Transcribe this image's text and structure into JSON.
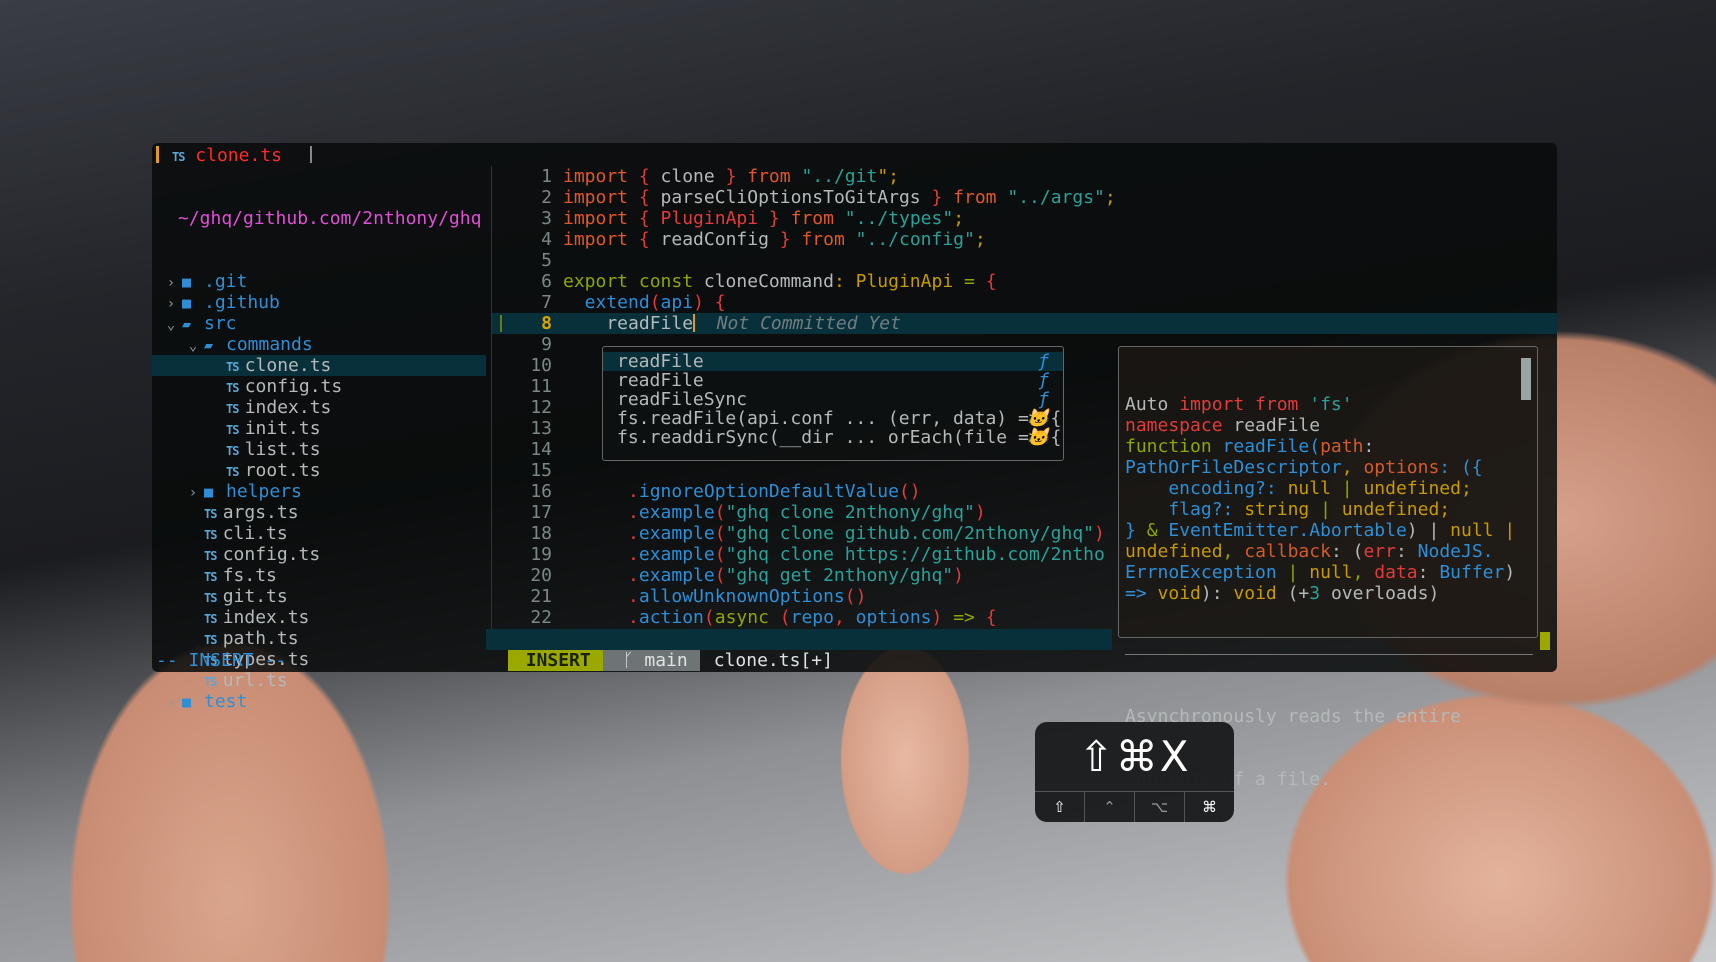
{
  "tabline": {
    "icon": "TS",
    "filename": "clone.ts"
  },
  "explorer": {
    "root_path": "~/ghq/github.com/2nthony/ghq",
    "items": [
      {
        "type": "dir",
        "name": ".git",
        "depth": 0,
        "open": false
      },
      {
        "type": "dir",
        "name": ".github",
        "depth": 0,
        "open": false
      },
      {
        "type": "dir",
        "name": "src",
        "depth": 0,
        "open": true
      },
      {
        "type": "dir",
        "name": "commands",
        "depth": 1,
        "open": true
      },
      {
        "type": "file",
        "name": "clone.ts",
        "depth": 2,
        "selected": true
      },
      {
        "type": "file",
        "name": "config.ts",
        "depth": 2
      },
      {
        "type": "file",
        "name": "index.ts",
        "depth": 2
      },
      {
        "type": "file",
        "name": "init.ts",
        "depth": 2
      },
      {
        "type": "file",
        "name": "list.ts",
        "depth": 2
      },
      {
        "type": "file",
        "name": "root.ts",
        "depth": 2
      },
      {
        "type": "dir",
        "name": "helpers",
        "depth": 1,
        "open": false
      },
      {
        "type": "file",
        "name": "args.ts",
        "depth": 1
      },
      {
        "type": "file",
        "name": "cli.ts",
        "depth": 1
      },
      {
        "type": "file",
        "name": "config.ts",
        "depth": 1
      },
      {
        "type": "file",
        "name": "fs.ts",
        "depth": 1
      },
      {
        "type": "file",
        "name": "git.ts",
        "depth": 1
      },
      {
        "type": "file",
        "name": "index.ts",
        "depth": 1
      },
      {
        "type": "file",
        "name": "path.ts",
        "depth": 1
      },
      {
        "type": "file",
        "name": "types.ts",
        "depth": 1
      },
      {
        "type": "file",
        "name": "url.ts",
        "depth": 1
      },
      {
        "type": "dir",
        "name": "test",
        "depth": 0,
        "open": false
      }
    ]
  },
  "editor": {
    "current_line": 8,
    "lines": [
      {
        "n": 1,
        "t": [
          [
            "import",
            "k"
          ],
          [
            " { ",
            "b"
          ],
          [
            "clone",
            "d"
          ],
          [
            " } ",
            "b"
          ],
          [
            "from",
            "k"
          ],
          [
            " \"",
            "s"
          ],
          [
            "../git",
            "s"
          ],
          [
            "\";",
            "y"
          ]
        ]
      },
      {
        "n": 2,
        "t": [
          [
            "import",
            "k"
          ],
          [
            " { ",
            "b"
          ],
          [
            "parseCliOptionsToGitArgs",
            "d"
          ],
          [
            " } ",
            "b"
          ],
          [
            "from",
            "k"
          ],
          [
            " \"../args\"",
            "s"
          ],
          [
            ";",
            "y"
          ]
        ]
      },
      {
        "n": 3,
        "t": [
          [
            "import",
            "k"
          ],
          [
            " { ",
            "b"
          ],
          [
            "PluginApi",
            "b"
          ],
          [
            " } ",
            "b"
          ],
          [
            "from",
            "k"
          ],
          [
            " \"../types\"",
            "s"
          ],
          [
            ";",
            "y"
          ]
        ]
      },
      {
        "n": 4,
        "t": [
          [
            "import",
            "k"
          ],
          [
            " { ",
            "b"
          ],
          [
            "readConfig",
            "d"
          ],
          [
            " } ",
            "b"
          ],
          [
            "from",
            "k"
          ],
          [
            " \"../config\"",
            "s"
          ],
          [
            ";",
            "y"
          ]
        ]
      },
      {
        "n": 5,
        "t": []
      },
      {
        "n": 6,
        "t": [
          [
            "export const",
            "g"
          ],
          [
            " cloneCommand",
            "d"
          ],
          [
            ": ",
            "y"
          ],
          [
            "PluginApi",
            "y"
          ],
          [
            " = ",
            "g"
          ],
          [
            "{",
            "b"
          ]
        ]
      },
      {
        "n": 7,
        "t": [
          [
            "  extend",
            "u"
          ],
          [
            "(",
            "b"
          ],
          [
            "api",
            "u"
          ],
          [
            ") ",
            "b"
          ],
          [
            "{",
            "b"
          ]
        ]
      },
      {
        "n": 8,
        "t": [
          [
            "    readFile",
            "d"
          ],
          [
            "|cursor",
            ""
          ],
          [
            "  Not Committed Yet",
            "c"
          ]
        ]
      },
      {
        "n": 9,
        "t": []
      },
      {
        "n": 10,
        "t": []
      },
      {
        "n": 11,
        "t": []
      },
      {
        "n": 12,
        "t": []
      },
      {
        "n": 13,
        "t": []
      },
      {
        "n": 14,
        "t": []
      },
      {
        "n": 15,
        "t": []
      },
      {
        "n": 16,
        "t": [
          [
            "      .",
            "b"
          ],
          [
            "ignoreOptionDefaultValue",
            "u"
          ],
          [
            "()",
            "b"
          ]
        ]
      },
      {
        "n": 17,
        "t": [
          [
            "      .",
            "b"
          ],
          [
            "example",
            "u"
          ],
          [
            "(",
            "b"
          ],
          [
            "\"ghq clone 2nthony/ghq\"",
            "s"
          ],
          [
            ")",
            "b"
          ]
        ]
      },
      {
        "n": 18,
        "t": [
          [
            "      .",
            "b"
          ],
          [
            "example",
            "u"
          ],
          [
            "(",
            "b"
          ],
          [
            "\"ghq clone github.com/2nthony/ghq\"",
            "s"
          ],
          [
            ")",
            "b"
          ]
        ]
      },
      {
        "n": 19,
        "t": [
          [
            "      .",
            "b"
          ],
          [
            "example",
            "u"
          ],
          [
            "(",
            "b"
          ],
          [
            "\"ghq clone https://github.com/2ntho",
            "s"
          ]
        ]
      },
      {
        "n": 20,
        "t": [
          [
            "      .",
            "b"
          ],
          [
            "example",
            "u"
          ],
          [
            "(",
            "b"
          ],
          [
            "\"ghq get 2nthony/ghq\"",
            "s"
          ],
          [
            ")",
            "b"
          ]
        ]
      },
      {
        "n": 21,
        "t": [
          [
            "      .",
            "b"
          ],
          [
            "allowUnknownOptions",
            "u"
          ],
          [
            "()",
            "b"
          ]
        ]
      },
      {
        "n": 22,
        "t": [
          [
            "      .",
            "b"
          ],
          [
            "action",
            "u"
          ],
          [
            "(",
            "b"
          ],
          [
            "async",
            "g"
          ],
          [
            " (",
            "b"
          ],
          [
            "repo",
            "u"
          ],
          [
            ", ",
            "b"
          ],
          [
            "options",
            "u"
          ],
          [
            ") ",
            "b"
          ],
          [
            "=>",
            "g"
          ],
          [
            " {",
            "b"
          ]
        ]
      }
    ]
  },
  "completion": {
    "items": [
      {
        "label": "readFile",
        "kind": "ƒ",
        "kind_icon": "function-icon",
        "selected": true
      },
      {
        "label": "readFile",
        "kind": "ƒ",
        "kind_icon": "function-icon"
      },
      {
        "label": "readFileSync",
        "kind": "ƒ",
        "kind_icon": "function-icon"
      },
      {
        "label": "fs.readFile(api.conf ... (err, data) => {",
        "kind": "🐱",
        "kind_icon": "snippet-cat-icon"
      },
      {
        "label": "fs.readdirSync(__dir ... orEach(file => {",
        "kind": "🐱",
        "kind_icon": "snippet-cat-icon"
      }
    ]
  },
  "documentation": {
    "signature": [
      [
        [
          "Auto ",
          "d"
        ],
        [
          "import from",
          "b"
        ],
        [
          " 'fs'",
          "s"
        ]
      ],
      [
        [
          "namespace",
          "b"
        ],
        [
          " readFile",
          "d"
        ]
      ],
      [
        [
          "function",
          "g"
        ],
        [
          " readFile(",
          "u"
        ],
        [
          "path",
          "o"
        ],
        [
          ":",
          "d"
        ]
      ],
      [
        [
          "PathOrFileDescriptor",
          "u"
        ],
        [
          ", ",
          "y"
        ],
        [
          "options",
          "o"
        ],
        [
          ": ({",
          "u"
        ]
      ],
      [
        [
          "    encoding?: ",
          "u"
        ],
        [
          "null",
          "y"
        ],
        [
          " | ",
          "g"
        ],
        [
          "undefined;",
          "y"
        ]
      ],
      [
        [
          "    flag?: ",
          "u"
        ],
        [
          "string",
          "y"
        ],
        [
          " | ",
          "g"
        ],
        [
          "undefined;",
          "y"
        ]
      ],
      [
        [
          "} ",
          "u"
        ],
        [
          "& ",
          "g"
        ],
        [
          "EventEmitter.Abortable",
          "u"
        ],
        [
          ") | ",
          "d"
        ],
        [
          "null |",
          "y"
        ]
      ],
      [
        [
          "undefined",
          "y"
        ],
        [
          ", ",
          "g"
        ],
        [
          "callback",
          "o"
        ],
        [
          ": (",
          "d"
        ],
        [
          "err",
          "b"
        ],
        [
          ": ",
          "d"
        ],
        [
          "NodeJS.",
          "u"
        ]
      ],
      [
        [
          "ErrnoException",
          "u"
        ],
        [
          " | ",
          "g"
        ],
        [
          "null",
          "y"
        ],
        [
          ", ",
          "g"
        ],
        [
          "data",
          "b"
        ],
        [
          ": ",
          "d"
        ],
        [
          "Buffer",
          "u"
        ],
        [
          ")",
          "d"
        ]
      ],
      [
        [
          "=>",
          "u"
        ],
        [
          " void",
          "y"
        ],
        [
          "): ",
          "d"
        ],
        [
          "void",
          "y"
        ],
        [
          " (+",
          "d"
        ],
        [
          "3",
          "s"
        ],
        [
          " overloads)",
          "d"
        ]
      ]
    ],
    "description": [
      "Asynchronously reads the entire",
      "contents of a file."
    ]
  },
  "statusline": {
    "mode": "INSERT",
    "branch_icon": "git-branch-icon",
    "branch": "main",
    "file": "clone.ts[+]"
  },
  "cmdline": "-- INSERT --",
  "keycast": {
    "combo": "⇧⌘X",
    "modifiers": [
      {
        "glyph": "⇧",
        "name": "shift",
        "active": true
      },
      {
        "glyph": "⌃",
        "name": "control",
        "active": false
      },
      {
        "glyph": "⌥",
        "name": "option",
        "active": false
      },
      {
        "glyph": "⌘",
        "name": "command",
        "active": true
      }
    ]
  },
  "colors": {
    "accent_mode": "#9aa800",
    "cursorline": "#08303b",
    "path": "#e24fd7",
    "folder": "#2f8fd6"
  }
}
